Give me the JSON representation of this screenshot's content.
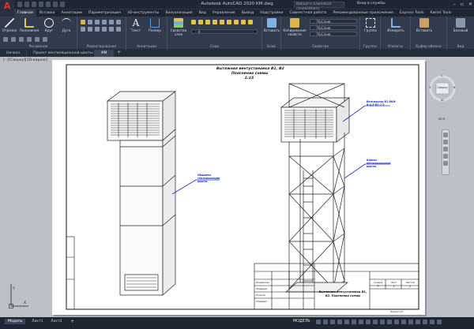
{
  "titlebar": {
    "title": "Autodesk AutoCAD 2020   КМ.dwg",
    "search_placeholder": "Введите ключевое слово/фразу",
    "signin": "Вход в службы"
  },
  "ribbon_tabs": [
    "Главная",
    "Вставка",
    "Аннотации",
    "Параметризация",
    "3D-инструменты",
    "Визуализация",
    "Вид",
    "Управление",
    "Вывод",
    "Надстройки",
    "Совместная работа",
    "Рекомендованные приложения",
    "Express Tools",
    "Kwilet Tools"
  ],
  "ribbon": {
    "draw_panel": "Рисование",
    "edit_panel": "Редактирование",
    "annot_panel": "Аннотации",
    "layers_panel": "Слои",
    "block_panel": "Блок",
    "props_panel": "Свойства",
    "groups_panel": "Группы",
    "utilities_panel": "Утилиты",
    "clipboard_panel": "Буфер обмена",
    "view_panel": "Вид",
    "btn_segment": "Отрезок",
    "btn_polyline": "Полилиния",
    "btn_circle": "Круг",
    "btn_arc": "Дуга",
    "btn_text": "Текст",
    "btn_dimension": "Размер",
    "btn_layer_props": "Свойства слоя",
    "btn_insert": "Вставить",
    "btn_copy_props": "Копирование свойств",
    "btn_group": "Группа",
    "btn_measure": "Измерить",
    "btn_paste": "Вставить",
    "btn_base": "Базовый",
    "layer_value": "0",
    "prop_layer": "ПоСлою",
    "prop_color": "ПоСлою",
    "prop_linetype": "ПоСлою"
  },
  "doc_tabs": [
    "Начало",
    "Проект вентиляционной шахты",
    "КМ"
  ],
  "viewport_label": "[−][Сверху][2D-каркас]",
  "viewcube": {
    "face": "Сверху",
    "north": "С",
    "south": "Ю",
    "east": "В",
    "west": "З",
    "wcs": "МСК"
  },
  "drawing": {
    "title_line1": "Вытяжная вентустановка В1, В2",
    "title_line2": "Пояснения схемы",
    "title_line3": "1:15",
    "leader_left": "Обшивка теплоизоляции шахты",
    "leader_right_top": "Вентилятор В1 ВКИ-В-4,5-В2-1-3",
    "leader_right_mid": "Каркас вентиляционной шахты",
    "stamp_title": "Вытяжная вентустановка В1, В2. Пояснения схемы",
    "stamp_col1": "Стадия",
    "stamp_col2": "Лист",
    "stamp_col3": "Листов",
    "stamp_val1": "Р",
    "stamp_val2": "1",
    "stamp_val3": "1",
    "stamp_role1": "Разработал",
    "stamp_role2": "Проверил",
    "stamp_role3": "Н.контр.",
    "stamp_role4": "Утвердил",
    "format": "Формат А3"
  },
  "layout_tabs": [
    "Модель",
    "Лист1",
    "Лист2"
  ],
  "status": {
    "model_label": "МОДЕЛЬ"
  },
  "ucs": {
    "x": "X",
    "y": "Y"
  },
  "colors": {
    "chrome_dark": "#1f2633",
    "ribbon_bg": "#323b4d",
    "canvas_bg": "#bdc1c7",
    "sheet_bg": "#ffffff",
    "annotation_blue": "#1c2fd6"
  }
}
